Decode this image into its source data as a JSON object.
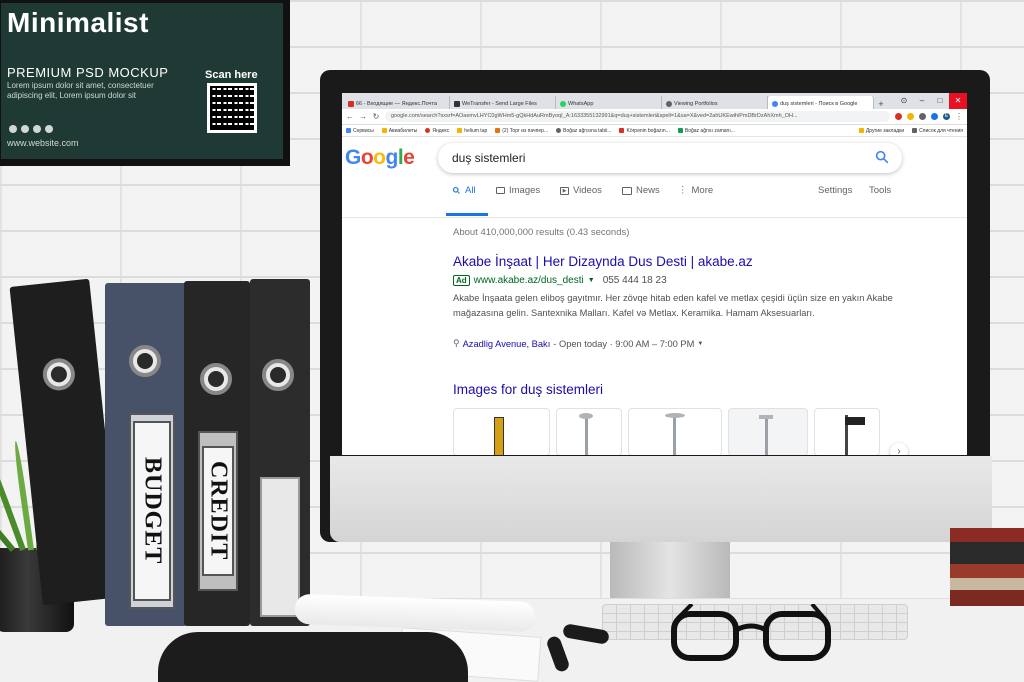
{
  "poster": {
    "title": "Minimalist",
    "subtitle": "PREMIUM PSD MOCKUP",
    "body": "Lorem ipsum dolor sit amet, consectetuer adipiscing elit, Lorem ipsum dolor sit",
    "website": "www.website.com",
    "scan_label": "Scan here"
  },
  "browser": {
    "tabs": [
      {
        "label": "66 - Входящие — Яндекс.Почта",
        "icon": "gmail-icon",
        "color": "#d93025"
      },
      {
        "label": "WeTransfer - Send Large Files",
        "icon": "wetransfer-icon",
        "color": "#333333"
      },
      {
        "label": "WhatsApp",
        "icon": "whatsapp-icon",
        "color": "#25d366"
      },
      {
        "label": "Viewing Portfolios",
        "icon": "portfolio-icon",
        "color": "#5f6368"
      },
      {
        "label": "duş sistemleri - Поиск в Google",
        "icon": "google-icon",
        "color": "#4285f4"
      }
    ],
    "url": "google.com/search?sxsrf=AOaemvLHYC0gWHm5-gQkHdAuRmByoqI_A:1633355132991&q=duş+sistemleri&spell=1&sa=X&ved=2ahUKEwihiPmDBrDzAhXmh_OH...",
    "profile_initial": "E",
    "bookmarks": [
      {
        "label": "Сервисы",
        "color": "#4285f4"
      },
      {
        "label": "Авиабилеты",
        "color": "#f4b400"
      },
      {
        "label": "Яндекс",
        "color": "#d93025"
      },
      {
        "label": "helium tap",
        "color": "#1a73e8"
      },
      {
        "label": "(2) Торг из пачпер...",
        "color": "#e8710a"
      },
      {
        "label": "Boğaz ağrısına tabii...",
        "color": "#5f6368"
      },
      {
        "label": "Körpənin boğazın...",
        "color": "#d93025"
      },
      {
        "label": "Boğaz ağrısı zamanı...",
        "color": "#0f9d58"
      }
    ],
    "bookmarks_right": [
      {
        "label": "Другие закладки",
        "color": "#f4b400"
      },
      {
        "label": "Список для чтения",
        "color": "#5f6368"
      }
    ]
  },
  "google": {
    "logo": "Google",
    "query": "duş sistemleri",
    "tabs": {
      "all": "All",
      "images": "Images",
      "videos": "Videos",
      "news": "News",
      "more": "More",
      "settings": "Settings",
      "tools": "Tools"
    },
    "stats": "About 410,000,000 results (0.43 seconds)",
    "ad": {
      "title": "Akabe İnşaat | Her Dizaynda Dus Desti | akabe.az",
      "badge": "Ad",
      "url": "www.akabe.az/dus_desti",
      "phone": "055 444 18 23",
      "snippet": "Akabe İnşaata gelen eliboş gayıtmır. Her zövqe hitab eden kafel ve metlax çeşidi üçün size en yakın Akabe mağazasına gelin. Santexnika Malları. Kafel və Metlax. Keramika. Hamam Aksesuarları.",
      "location": "Azadlig Avenue, Bakı",
      "hours": "- Open today · 9:00 AM – 7:00 PM"
    },
    "images_heading": "Images for duş sistemleri"
  },
  "binders": {
    "budget": "BUDGET",
    "credit": "CREDIT"
  },
  "colors": {
    "google_blue": "#4285f4",
    "google_red": "#ea4335",
    "google_yellow": "#fbbc05",
    "google_green": "#34a853",
    "link": "#1a0dab",
    "ad_green": "#006621",
    "poster_green": "#1f3a34"
  }
}
